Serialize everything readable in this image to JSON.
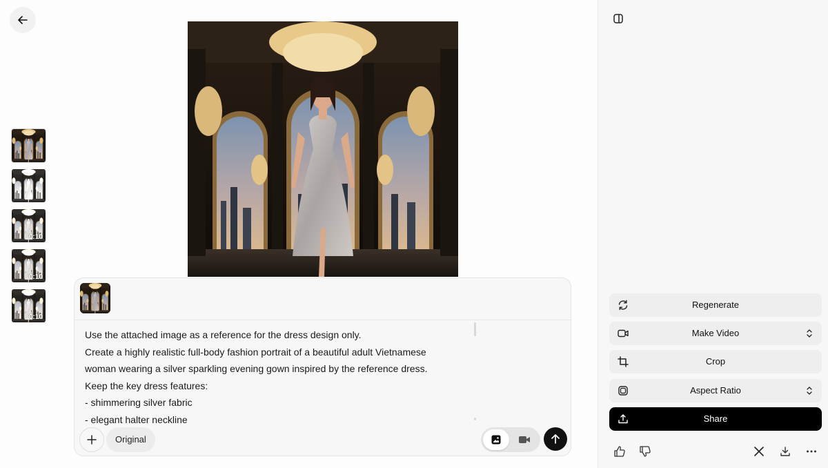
{
  "nav": {
    "back_icon": "arrow-left-icon"
  },
  "thumbnails": [
    {
      "kind": "image",
      "duration": ""
    },
    {
      "kind": "video",
      "duration": ""
    },
    {
      "kind": "video",
      "duration": "0:10"
    },
    {
      "kind": "video",
      "duration": "0:10"
    },
    {
      "kind": "video",
      "duration": "0:10"
    }
  ],
  "composer": {
    "prompt_lines": [
      "Use the attached image as a reference for the dress design only.",
      "Create a highly realistic full-body fashion portrait of a beautiful adult Vietnamese",
      "woman wearing a silver sparkling evening gown inspired by the reference dress.",
      "Keep the key dress features:",
      "- shimmering silver fabric",
      "- elegant halter neckline"
    ],
    "original_label": "Original",
    "modes": [
      "image-mode-icon",
      "video-mode-icon"
    ]
  },
  "panel": {
    "actions": [
      {
        "label": "Regenerate",
        "icon": "refresh-icon"
      },
      {
        "label": "Make Video",
        "icon": "video-camera-icon"
      },
      {
        "label": "Crop",
        "icon": "crop-icon"
      },
      {
        "label": "Aspect Ratio",
        "icon": "aspect-ratio-icon"
      },
      {
        "label": "Share",
        "icon": "upload-icon"
      }
    ]
  },
  "colors": {
    "accent": "#000000",
    "panel_bg": "#f7f7f7",
    "button_bg": "#eeeeee"
  }
}
